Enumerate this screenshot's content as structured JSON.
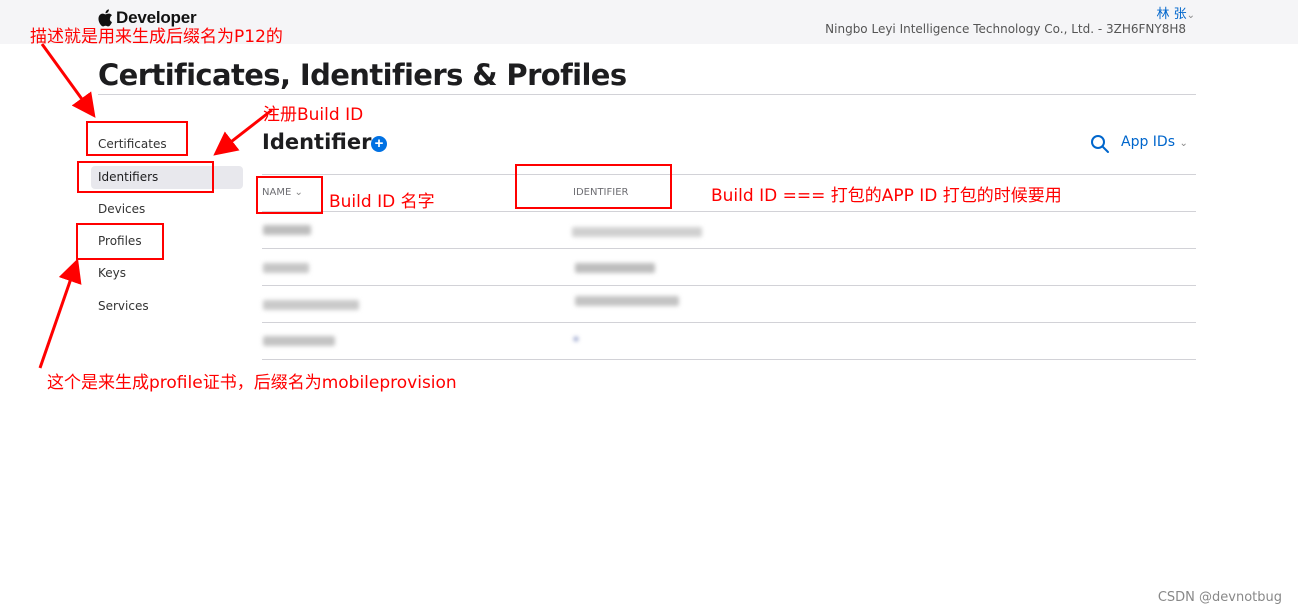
{
  "header": {
    "brand_text": "Developer",
    "user_name": "林 张",
    "team_name": "Ningbo Leyi Intelligence Technology Co., Ltd. - 3ZH6FNY8H8"
  },
  "page_title": "Certificates, Identifiers & Profiles",
  "sidebar": {
    "items": [
      {
        "label": "Certificates"
      },
      {
        "label": "Identifiers"
      },
      {
        "label": "Devices"
      },
      {
        "label": "Profiles"
      },
      {
        "label": "Keys"
      },
      {
        "label": "Services"
      }
    ],
    "active": "Identifiers"
  },
  "main": {
    "section_title": "Identifiers",
    "add_icon": "plus-circle-icon",
    "search_icon": "search-icon",
    "filter_label": "App IDs",
    "columns": {
      "name": "NAME",
      "identifier": "IDENTIFIER"
    },
    "rows_note": "row values are blurred/redacted in the screenshot"
  },
  "annotations": {
    "certificates": "描述就是用来生成后缀名为P12的",
    "identifiers": "注册Build ID",
    "name_column": "Build ID 名字",
    "identifier_column": "Build ID === 打包的APP ID 打包的时候要用",
    "profiles": "这个是来生成profile证书，后缀名为mobileprovision"
  },
  "colors": {
    "accent": "#0071e3",
    "link": "#0066cc",
    "annotation": "#ff0000",
    "topbar_bg": "#f5f5f7"
  },
  "watermark": "CSDN @devnotbug"
}
